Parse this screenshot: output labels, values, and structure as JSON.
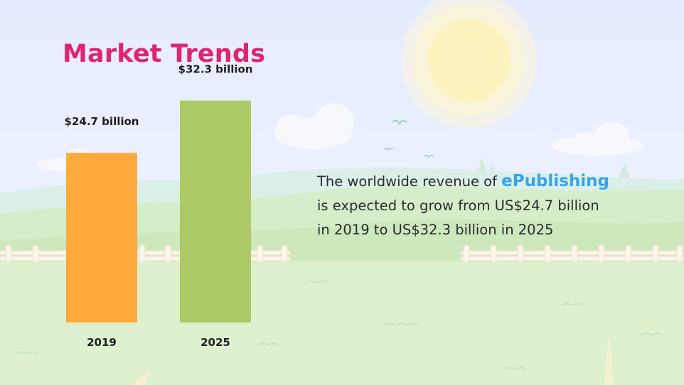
{
  "slide": {
    "title": "Market Trends",
    "description": {
      "line1_prefix": "The worldwide revenue of ",
      "highlight": "ePublishing",
      "line2": "is expected to grow from US$24.7 billion",
      "line3": "in 2019 to US$32.3 billion in 2025"
    }
  },
  "colors": {
    "title": "#e0246f",
    "highlight": "#3aa3e8",
    "bar_2019": "#ffaa3c",
    "bar_2025": "#acc965"
  },
  "chart_data": {
    "type": "bar",
    "title": "",
    "xlabel": "",
    "ylabel": "",
    "categories": [
      "2019",
      "2025"
    ],
    "values": [
      24.7,
      32.3
    ],
    "value_labels": [
      "$24.7 billion",
      "$32.3 billion"
    ],
    "ylim": [
      0,
      35
    ],
    "grid": false,
    "legend": "none"
  }
}
